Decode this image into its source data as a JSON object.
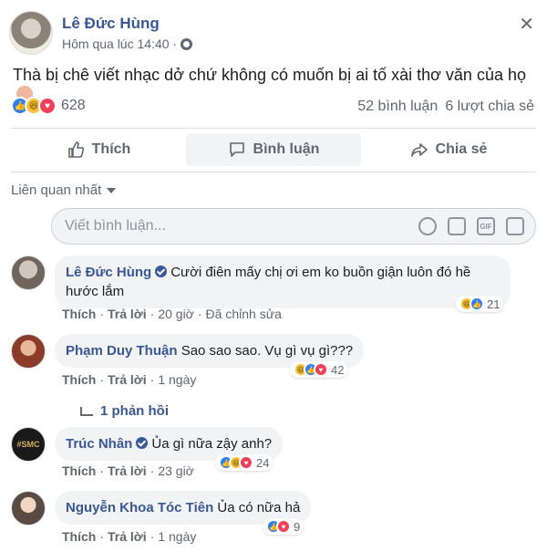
{
  "post": {
    "author": "Lê Đức Hùng",
    "timestamp": "Hôm qua lúc 14:40 ·",
    "text": "Thà bị chê viết nhạc dở chứ không có muốn bị ai tố xài thơ văn của họ",
    "reaction_count": "628",
    "comments_count": "52 bình luận",
    "shares_count": "6 lượt chia sẻ"
  },
  "actions": {
    "like": "Thích",
    "comment": "Bình luận",
    "share": "Chia sẻ"
  },
  "sort_label": "Liên quan nhất",
  "comment_input": {
    "placeholder": "Viết bình luận..."
  },
  "comments": [
    {
      "name": "Lê Đức Hùng",
      "text": "Cười điên mấy chị ơi em ko buồn giận luôn đó hề hước lắm",
      "like": "Thích",
      "reply": "Trả lời",
      "time": "20 giờ",
      "edited": "Đã chỉnh sửa",
      "reaction_count": "21"
    },
    {
      "name": "Phạm Duy Thuận",
      "text": "Sao sao sao. Vụ gì vụ gì???",
      "like": "Thích",
      "reply": "Trả lời",
      "time": "1 ngày",
      "reaction_count": "42",
      "replies": "1 phản hồi"
    },
    {
      "name": "Trúc Nhân",
      "text": "Ủa gì nữa zậy anh?",
      "like": "Thích",
      "reply": "Trả lời",
      "time": "23 giờ",
      "reaction_count": "24"
    },
    {
      "name": "Nguyễn Khoa Tóc Tiên",
      "text": "Ủa có nữa hả",
      "like": "Thích",
      "reply": "Trả lời",
      "time": "1 ngày",
      "reaction_count": "9"
    }
  ],
  "colors": {
    "name_blue": "#385898",
    "like_blue": "#2d7ff9",
    "love_red": "#f33e58",
    "haha_yellow": "#f7c13a"
  },
  "icons": [
    "globe-icon",
    "close-icon",
    "like-icon",
    "comment-icon",
    "share-icon",
    "emoji-icon",
    "camera-icon",
    "gif-icon",
    "sticker-icon"
  ]
}
